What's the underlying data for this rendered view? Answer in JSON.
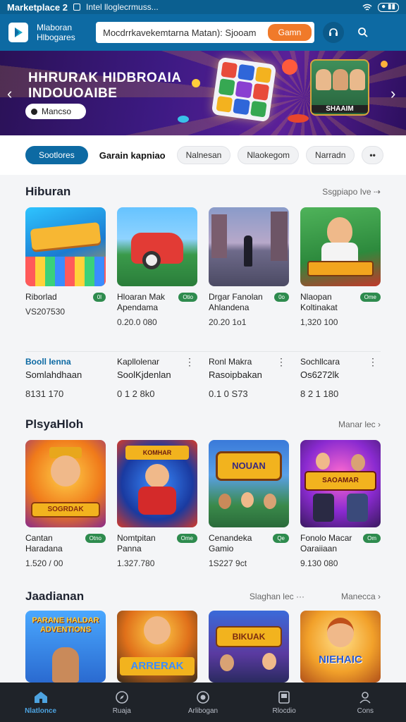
{
  "status_bar": {
    "app_title": "Marketplace 2",
    "notification": "Intel lloglecrmuss...",
    "battery": "● ▮▮"
  },
  "top_bar": {
    "brand_line1": "Mlaboran",
    "brand_line2": "Hlbogares",
    "search_value": "Mocdrrkavekemtarna Matan): Sjooam",
    "search_button": "Gamn"
  },
  "hero": {
    "headline": "HHRURAK HIDBROAIA INDOUOAIBE",
    "button_label": "Mancso",
    "card_caption": "SHAAIM"
  },
  "filters": {
    "items": [
      {
        "label": "Sootlores",
        "style": "active"
      },
      {
        "label": "Garain kapniao",
        "style": "bold"
      },
      {
        "label": "Nalnesan",
        "style": "normal"
      },
      {
        "label": "Nlaokegom",
        "style": "normal"
      },
      {
        "label": "Narradn",
        "style": "normal"
      },
      {
        "label": "••",
        "style": "more"
      }
    ]
  },
  "section1": {
    "title": "Hiburan",
    "link": "Ssgpiapo Ive ⇢",
    "tiles": [
      {
        "name": "Riborlad",
        "badge": "0l",
        "count": "VS207530"
      },
      {
        "name": "Hloaran Mak Apendama",
        "badge": "Otio",
        "count": "0.20.0 080"
      },
      {
        "name": "Drgar Fanolan Ahlandena",
        "badge": "0o",
        "count": "20.20 1o1"
      },
      {
        "name": "Nlaopan Koltinakat",
        "badge": "Ome",
        "count": "1,320 100"
      }
    ]
  },
  "list_rows": [
    {
      "t1": "Booll Ienna",
      "t2": "Somlahdhaan",
      "t3": "8131 170"
    },
    {
      "t1": "Kapllolenar",
      "t2": "SoolKjdenlan",
      "t3": "0 1 2 8k0"
    },
    {
      "t1": "Ronl Makra",
      "t2": "Rasoipbakan",
      "t3": "0.1 0 S73"
    },
    {
      "t1": "Sochllcara",
      "t2": "Os6272lk",
      "t3": "8 2 1 180"
    }
  ],
  "section2": {
    "title": "PlsyaHloh",
    "link": "Manar lec ›",
    "tiles": [
      {
        "name": "Cantan Haradana",
        "badge": "Otno",
        "count": "1.520 / 00",
        "caption": "SOGRDAK"
      },
      {
        "name": "Nomtpitan Panna",
        "badge": "Ome",
        "count": "1.327.780",
        "caption": "KOMHAR"
      },
      {
        "name": "Cenandeka Gamio",
        "badge": "Qe",
        "count": "1S227 9ct",
        "caption": "NOUAN"
      },
      {
        "name": "Fonolo Macar Oaraiiaan",
        "badge": "Om",
        "count": "9.130 080",
        "caption": "SAOAMAR"
      }
    ]
  },
  "section3": {
    "title": "Jaadianan",
    "link_a": "Slaghan lec ···",
    "link_b": "Manecca ›",
    "tiles": [
      {
        "caption": "PARANE HALDAR ADVENTIONS"
      },
      {
        "caption": "ARRERAK"
      },
      {
        "caption": "BIKUAK"
      },
      {
        "caption": "NIEHAIC"
      }
    ]
  },
  "bottom_nav": {
    "items": [
      {
        "label": "Nlatlonce",
        "icon": "home-icon",
        "active": true
      },
      {
        "label": "Ruaja",
        "icon": "compass-icon",
        "active": false
      },
      {
        "label": "Arlibogan",
        "icon": "globe-icon",
        "active": false
      },
      {
        "label": "Rlocdio",
        "icon": "library-icon",
        "active": false
      },
      {
        "label": "Cons",
        "icon": "profile-icon",
        "active": false
      }
    ]
  },
  "colors": {
    "primary": "#0d6aa3",
    "accent": "#f07a2a",
    "badge": "#2e8b4e",
    "nav_bg": "#1f2329"
  }
}
